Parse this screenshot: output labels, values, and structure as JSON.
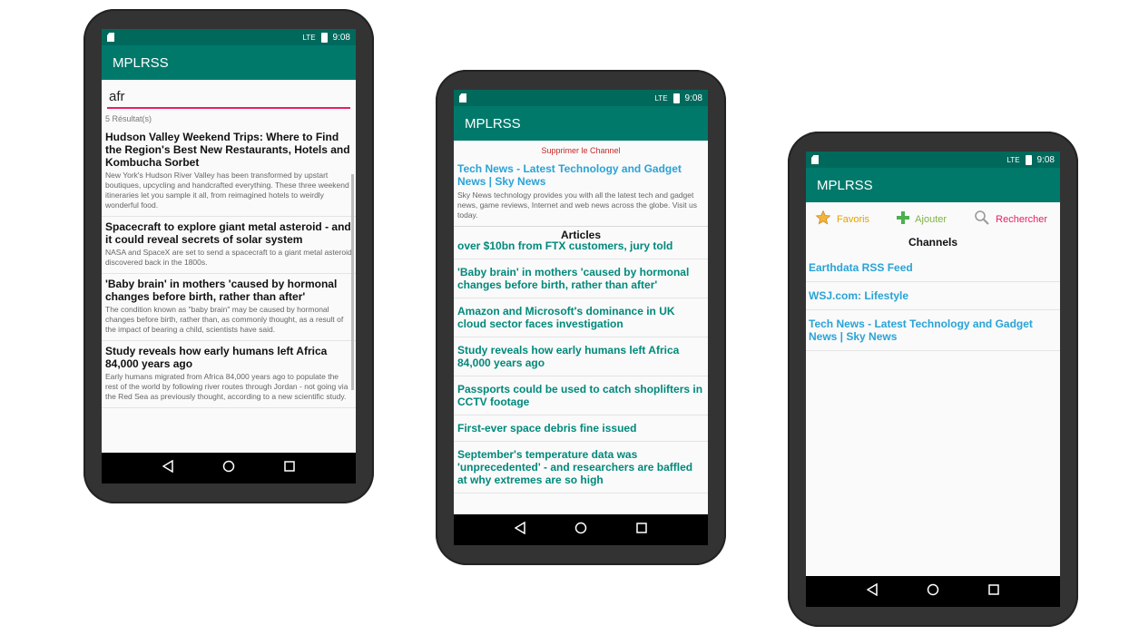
{
  "status": {
    "time": "9:08",
    "signal": "LTE"
  },
  "phone1": {
    "app_title": "MPLRSS",
    "search": {
      "value": "afr",
      "placeholder": ""
    },
    "results_count": "5 Résultat(s)",
    "results": [
      {
        "title": "Hudson Valley Weekend Trips: Where to Find the Region's Best New Restaurants, Hotels and Kombucha Sorbet",
        "desc": "New York's Hudson River Valley has been transformed by upstart boutiques, upcycling and handcrafted everything. These three weekend itineraries let you sample it all, from reimagined hotels to weirdly wonderful food."
      },
      {
        "title": "Spacecraft to explore giant metal asteroid - and it could reveal secrets of solar system",
        "desc": "NASA and SpaceX are set to send a spacecraft to a giant metal asteroid discovered back in the 1800s."
      },
      {
        "title": "'Baby brain' in mothers 'caused by hormonal changes before birth, rather than after'",
        "desc": "The condition known as \"baby brain\" may be caused by hormonal changes before birth, rather than, as commonly thought, as a result of the impact of bearing a child, scientists have said."
      },
      {
        "title": "Study reveals how early humans left Africa 84,000 years ago",
        "desc": "Early humans migrated from Africa 84,000 years ago to populate the rest of the world by following river routes through Jordan - not going via the Red Sea as previously thought, according to a new scientific study."
      }
    ]
  },
  "phone2": {
    "app_title": "MPLRSS",
    "delete_label": "Supprimer le Channel",
    "channel": {
      "title": "Tech News - Latest Technology and Gadget News | Sky News",
      "desc": "Sky News technology provides you with all the latest tech and gadget news, game reviews, Internet and web news across the globe. Visit us today."
    },
    "articles_heading": "Articles",
    "articles": [
      "over $10bn from FTX customers, jury told",
      "'Baby brain' in mothers 'caused by hormonal changes before birth, rather than after'",
      "Amazon and Microsoft's dominance in UK cloud sector faces investigation",
      "Study reveals how early humans left Africa 84,000 years ago",
      "Passports could be used to catch shoplifters in CCTV footage",
      "First-ever space debris fine issued",
      "September's temperature data was 'unprecedented' - and researchers are baffled at why extremes are so high"
    ]
  },
  "phone3": {
    "app_title": "MPLRSS",
    "toolbar": {
      "favoris": "Favoris",
      "ajouter": "Ajouter",
      "rechercher": "Rechercher"
    },
    "channels_heading": "Channels",
    "channels": [
      "Earthdata RSS Feed",
      "WSJ.com: Lifestyle",
      "Tech News - Latest Technology and Gadget News | Sky News"
    ]
  },
  "colors": {
    "primary": "#00796b",
    "primary_dark": "#00695c",
    "accent": "#e91e63",
    "link": "#29a3d6",
    "article": "#00897b"
  }
}
